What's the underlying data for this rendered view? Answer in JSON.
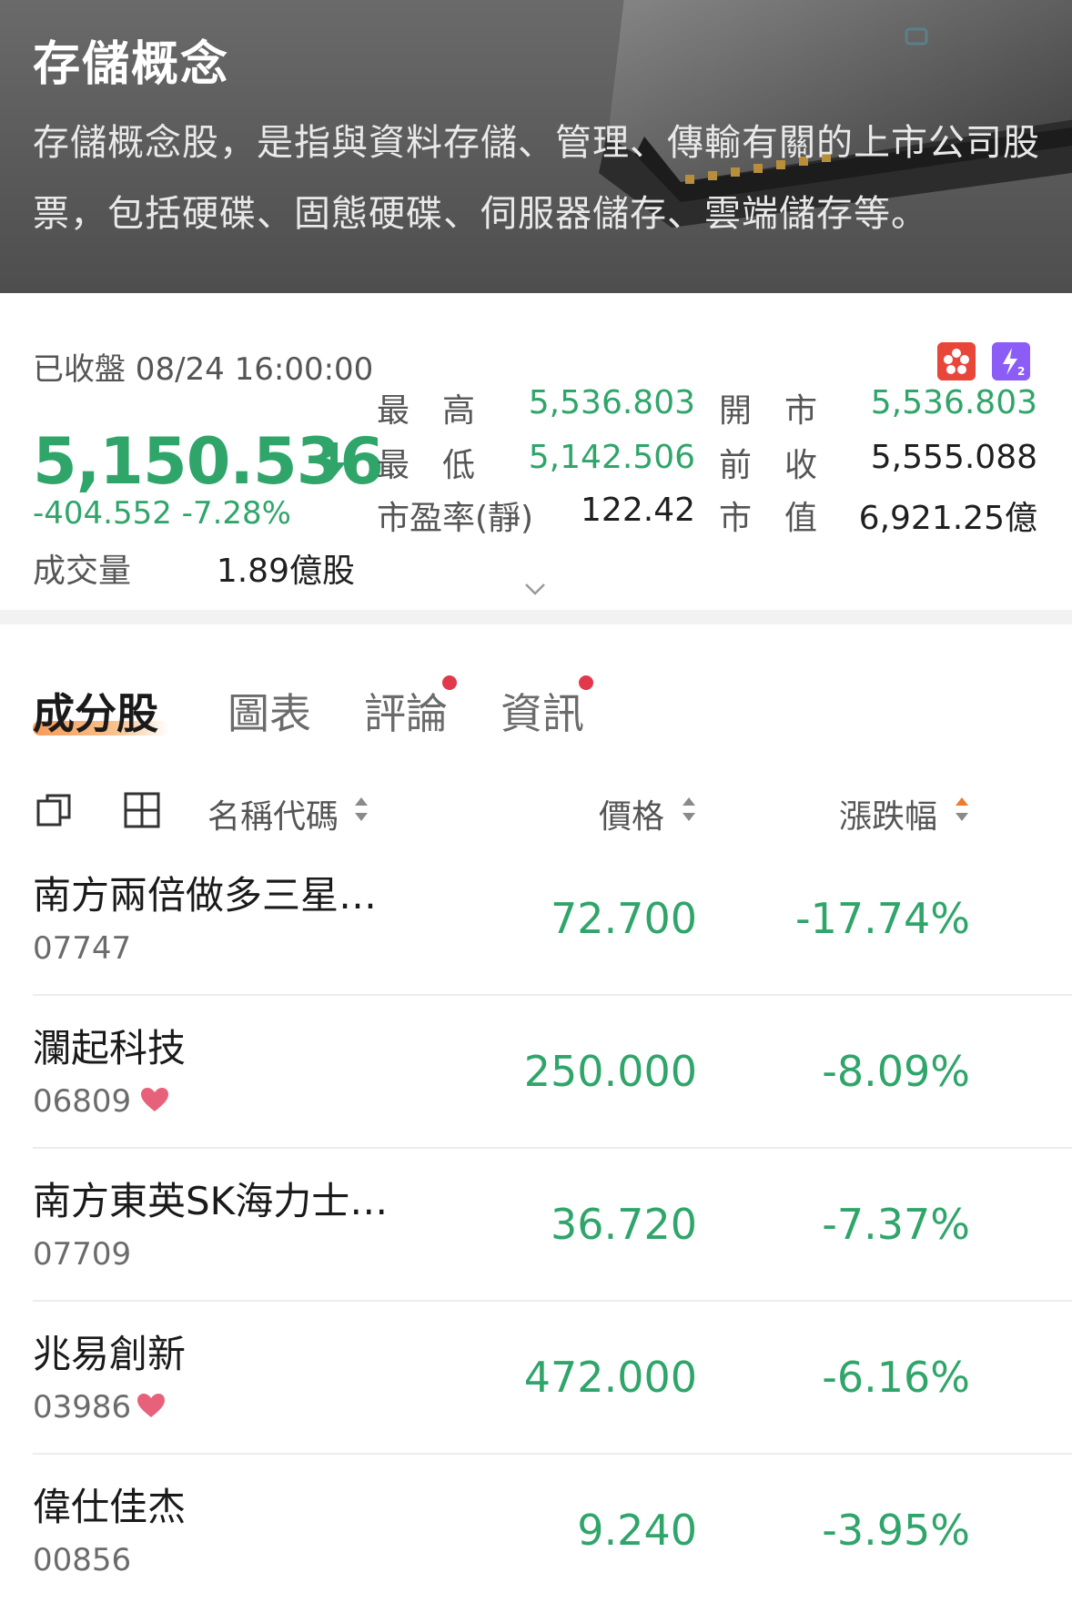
{
  "banner": {
    "title": "存儲概念",
    "description": "存儲概念股，是指與資料存儲、管理、傳輸有關的上市公司股票，包括硬碟、固態硬碟、伺服器儲存、雲端儲存等。"
  },
  "quote": {
    "status": "已收盤 08/24 16:00:00",
    "last_price": "5,150.536",
    "change": "-404.552 -7.28%",
    "volume_label": "成交量",
    "volume_value": "1.89億股",
    "stats": {
      "high_label": "最　高",
      "high_value": "5,536.803",
      "low_label": "最　低",
      "low_value": "5,142.506",
      "pe_label": "市盈率(靜)",
      "pe_value": "122.42",
      "open_label": "開　市",
      "open_value": "5,536.803",
      "prev_close_label": "前　收",
      "prev_close_value": "5,555.088",
      "mktcap_label": "市　值",
      "mktcap_value": "6,921.25億"
    },
    "colors": {
      "down": "#2fa56a"
    }
  },
  "tabs": [
    {
      "label": "成分股",
      "active": true,
      "dot": false
    },
    {
      "label": "圖表",
      "active": false,
      "dot": false
    },
    {
      "label": "評論",
      "active": false,
      "dot": true
    },
    {
      "label": "資訊",
      "active": false,
      "dot": true
    }
  ],
  "list_header": {
    "name_code": "名稱代碼",
    "price": "價格",
    "change_pct": "漲跌幅",
    "icons": [
      "external-window-icon",
      "grid-icon"
    ]
  },
  "rows": [
    {
      "name": "南方兩倍做多三星…",
      "code": "07747",
      "price": "72.700",
      "change": "-17.74%",
      "favorite": false
    },
    {
      "name": "瀾起科技",
      "code": "06809",
      "price": "250.000",
      "change": "-8.09%",
      "favorite": true
    },
    {
      "name": "南方東英SK海力士…",
      "code": "07709",
      "price": "36.720",
      "change": "-7.37%",
      "favorite": false
    },
    {
      "name": "兆易創新",
      "code": "03986",
      "price": "472.000",
      "change": "-6.16%",
      "favorite": true
    },
    {
      "name": "偉仕佳杰",
      "code": "00856",
      "price": "9.240",
      "change": "-3.95%",
      "favorite": false
    }
  ]
}
